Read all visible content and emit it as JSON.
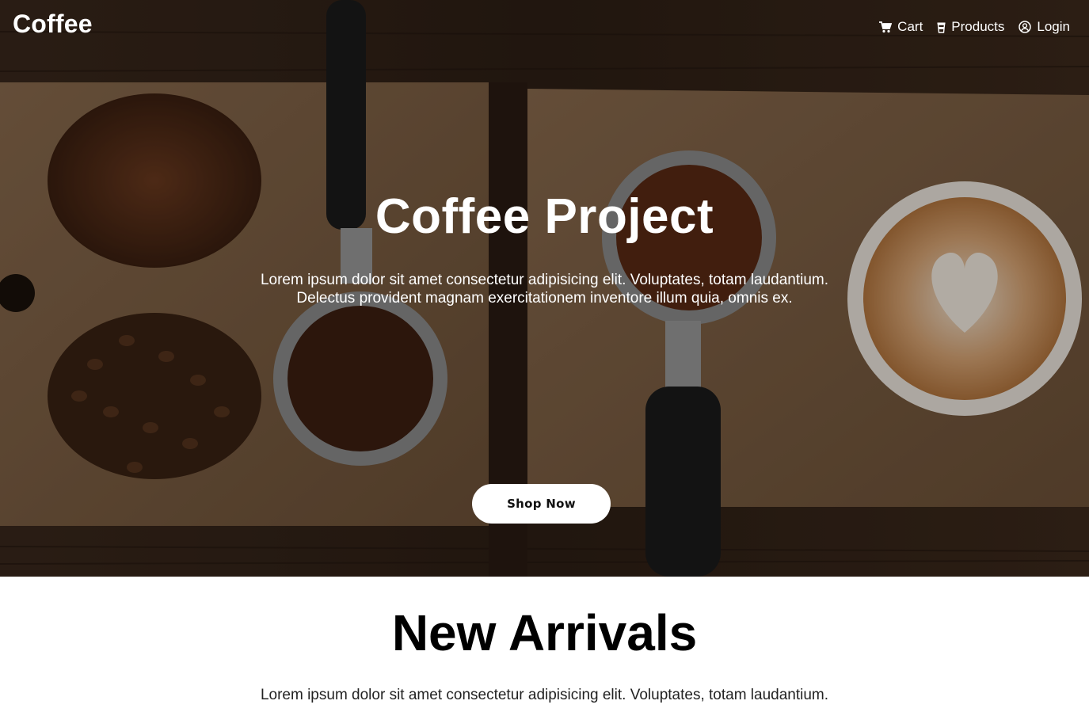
{
  "navbar": {
    "brand": "Coffee",
    "links": [
      {
        "label": "Cart",
        "icon": "cart-icon"
      },
      {
        "label": "Products",
        "icon": "coffee-cup-icon"
      },
      {
        "label": "Login",
        "icon": "user-circle-icon"
      }
    ]
  },
  "hero": {
    "title": "Coffee Project",
    "text_line1": "Lorem ipsum dolor sit amet consectetur adipisicing elit. Voluptates, totam laudantium.",
    "text_line2": "Delectus provident magnam exercitationem inventore illum quia, omnis ex.",
    "button_label": "Shop Now",
    "background_image": "coffee beans, grounds, portafilters and latte art on wooden boards"
  },
  "arrivals": {
    "title": "New Arrivals",
    "text": "Lorem ipsum dolor sit amet consectetur adipisicing elit. Voluptates, totam laudantium."
  },
  "colors": {
    "text_on_hero": "#ffffff",
    "button_bg": "#ffffff",
    "button_text": "#111111",
    "page_bg": "#ffffff"
  }
}
